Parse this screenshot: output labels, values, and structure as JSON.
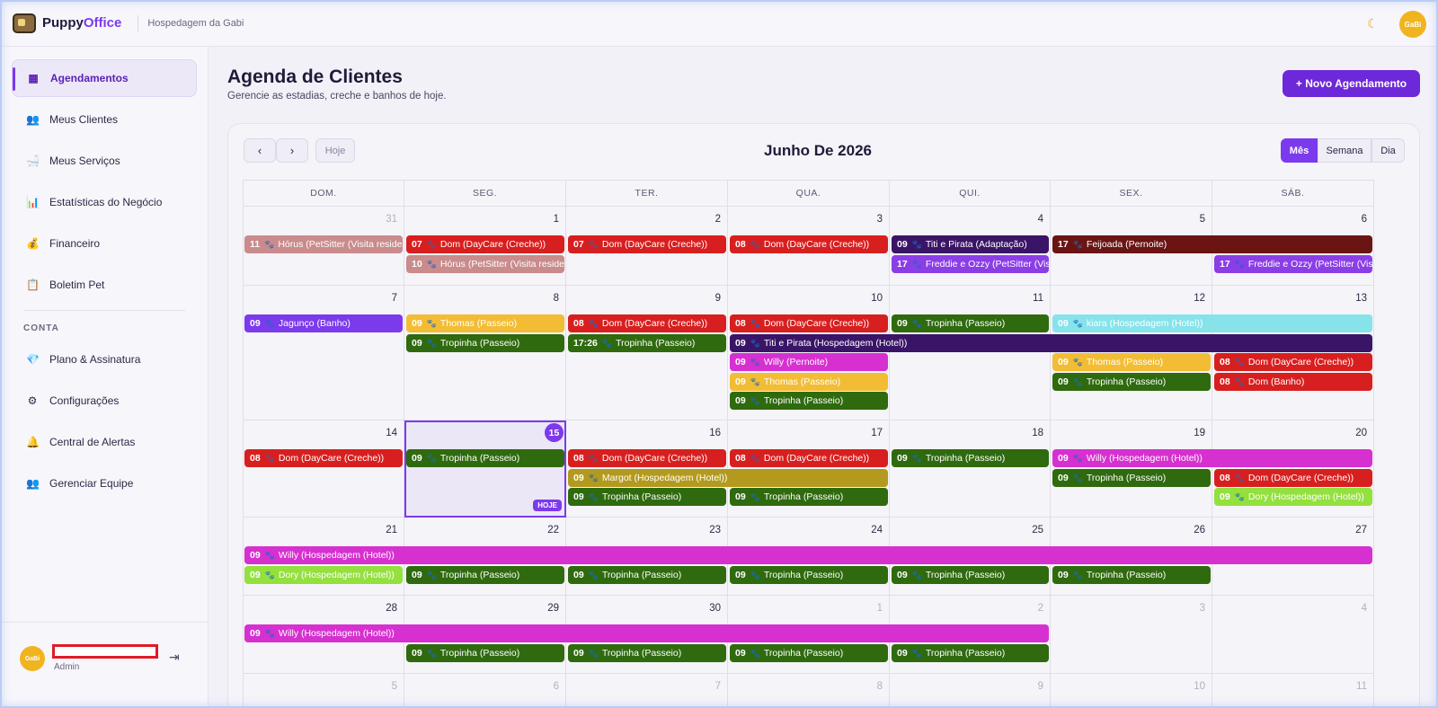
{
  "app": {
    "name_part1": "Puppy",
    "name_part2": "Office",
    "org": "Hospedagem da Gabi",
    "avatar_label": "GaBi"
  },
  "sidebar": {
    "items": [
      {
        "label": "Agendamentos",
        "icon": "calendar-icon",
        "glyph": "▦",
        "active": true
      },
      {
        "label": "Meus Clientes",
        "icon": "users-icon",
        "glyph": "👥",
        "active": false
      },
      {
        "label": "Meus Serviços",
        "icon": "bathtub-icon",
        "glyph": "🛁",
        "active": false
      },
      {
        "label": "Estatísticas do Negócio",
        "icon": "chart-icon",
        "glyph": "📊",
        "active": false
      },
      {
        "label": "Financeiro",
        "icon": "money-bag-icon",
        "glyph": "💰",
        "active": false
      },
      {
        "label": "Boletim Pet",
        "icon": "clipboard-icon",
        "glyph": "📋",
        "active": false
      }
    ],
    "section_label": "CONTA",
    "account_items": [
      {
        "label": "Plano & Assinatura",
        "icon": "diamond-icon",
        "glyph": "💎"
      },
      {
        "label": "Configurações",
        "icon": "gear-icon",
        "glyph": "⚙"
      },
      {
        "label": "Central de Alertas",
        "icon": "bell-icon",
        "glyph": "🔔"
      },
      {
        "label": "Gerenciar Equipe",
        "icon": "team-icon",
        "glyph": "👥"
      }
    ],
    "user": {
      "role": "Admin"
    }
  },
  "header": {
    "title": "Agenda de Clientes",
    "subtitle": "Gerencie as estadias, creche e banhos de hoje.",
    "new_button": "+ Novo Agendamento"
  },
  "calendar": {
    "title": "Junho De 2026",
    "prev": "‹",
    "next": "›",
    "today": "Hoje",
    "views": [
      "Mês",
      "Semana",
      "Dia"
    ],
    "active_view": "Mês",
    "weekdays": [
      "DOM.",
      "SEG.",
      "TER.",
      "QUA.",
      "QUI.",
      "SEX.",
      "SÁB."
    ],
    "today_badge": "HOJE",
    "today_date": 15,
    "weeks": [
      [
        {
          "d": 31,
          "o": true
        },
        {
          "d": 1
        },
        {
          "d": 2
        },
        {
          "d": 3
        },
        {
          "d": 4
        },
        {
          "d": 5
        },
        {
          "d": 6
        }
      ],
      [
        {
          "d": 7
        },
        {
          "d": 8
        },
        {
          "d": 9
        },
        {
          "d": 10
        },
        {
          "d": 11
        },
        {
          "d": 12
        },
        {
          "d": 13
        }
      ],
      [
        {
          "d": 14
        },
        {
          "d": 15
        },
        {
          "d": 16
        },
        {
          "d": 17
        },
        {
          "d": 18
        },
        {
          "d": 19
        },
        {
          "d": 20
        }
      ],
      [
        {
          "d": 21
        },
        {
          "d": 22
        },
        {
          "d": 23
        },
        {
          "d": 24
        },
        {
          "d": 25
        },
        {
          "d": 26
        },
        {
          "d": 27
        }
      ],
      [
        {
          "d": 28
        },
        {
          "d": 29
        },
        {
          "d": 30
        },
        {
          "d": 1,
          "o": true
        },
        {
          "d": 2,
          "o": true
        },
        {
          "d": 3,
          "o": true
        },
        {
          "d": 4,
          "o": true
        }
      ],
      [
        {
          "d": 5,
          "o": true
        },
        {
          "d": 6,
          "o": true
        },
        {
          "d": 7,
          "o": true
        },
        {
          "d": 8,
          "o": true
        },
        {
          "d": 9,
          "o": true
        },
        {
          "d": 10,
          "o": true
        },
        {
          "d": 11,
          "o": true
        }
      ]
    ],
    "colors": {
      "red": "#d81f1f",
      "rose": "#c98b8b",
      "navy": "#3a1567",
      "maroon": "#6b1414",
      "violet": "#8b3ee6",
      "purple": "#7c3aed",
      "yellow": "#f2bd34",
      "green": "#2f6a0f",
      "cyan": "#86e3ea",
      "magenta": "#d630d0",
      "olive": "#b39a1e",
      "lime": "#93e03e"
    },
    "events": [
      {
        "w": 0,
        "s": 0,
        "e": 0,
        "r": 0,
        "t": "11",
        "label": "Hórus (PetSitter (Visita residencial))",
        "c": "rose"
      },
      {
        "w": 0,
        "s": 1,
        "e": 1,
        "r": 0,
        "t": "07",
        "label": "Dom (DayCare (Creche))",
        "c": "red"
      },
      {
        "w": 0,
        "s": 1,
        "e": 1,
        "r": 1,
        "t": "10",
        "label": "Hórus (PetSitter (Visita residencial))",
        "c": "rose"
      },
      {
        "w": 0,
        "s": 2,
        "e": 2,
        "r": 0,
        "t": "07",
        "label": "Dom (DayCare (Creche))",
        "c": "red"
      },
      {
        "w": 0,
        "s": 3,
        "e": 3,
        "r": 0,
        "t": "08",
        "label": "Dom (DayCare (Creche))",
        "c": "red"
      },
      {
        "w": 0,
        "s": 4,
        "e": 4,
        "r": 0,
        "t": "09",
        "label": "Titi e Pirata (Adaptação)",
        "c": "navy"
      },
      {
        "w": 0,
        "s": 4,
        "e": 4,
        "r": 1,
        "t": "17",
        "label": "Freddie e Ozzy (PetSitter (Visita residencial))",
        "c": "violet"
      },
      {
        "w": 0,
        "s": 5,
        "e": 6,
        "r": 0,
        "t": "17",
        "label": "Feijoada (Pernoite)",
        "c": "maroon"
      },
      {
        "w": 0,
        "s": 6,
        "e": 6,
        "r": 1,
        "t": "17",
        "label": "Freddie e Ozzy (PetSitter (Visita residencial))",
        "c": "violet"
      },
      {
        "w": 1,
        "s": 0,
        "e": 0,
        "r": 0,
        "t": "09",
        "label": "Jagunço (Banho)",
        "c": "purple"
      },
      {
        "w": 1,
        "s": 1,
        "e": 1,
        "r": 0,
        "t": "09",
        "label": "Thomas (Passeio)",
        "c": "yellow"
      },
      {
        "w": 1,
        "s": 1,
        "e": 1,
        "r": 1,
        "t": "09",
        "label": "Tropinha (Passeio)",
        "c": "green"
      },
      {
        "w": 1,
        "s": 2,
        "e": 2,
        "r": 0,
        "t": "08",
        "label": "Dom (DayCare (Creche))",
        "c": "red"
      },
      {
        "w": 1,
        "s": 2,
        "e": 2,
        "r": 1,
        "t": "17:26",
        "label": "Tropinha (Passeio)",
        "c": "green"
      },
      {
        "w": 1,
        "s": 3,
        "e": 3,
        "r": 0,
        "t": "08",
        "label": "Dom (DayCare (Creche))",
        "c": "red"
      },
      {
        "w": 1,
        "s": 3,
        "e": 6,
        "r": 1,
        "t": "09",
        "label": "Titi e Pirata (Hospedagem (Hotel))",
        "c": "navy"
      },
      {
        "w": 1,
        "s": 3,
        "e": 3,
        "r": 2,
        "t": "09",
        "label": "Willy (Pernoite)",
        "c": "magenta"
      },
      {
        "w": 1,
        "s": 3,
        "e": 3,
        "r": 3,
        "t": "09",
        "label": "Thomas (Passeio)",
        "c": "yellow"
      },
      {
        "w": 1,
        "s": 3,
        "e": 3,
        "r": 4,
        "t": "09",
        "label": "Tropinha (Passeio)",
        "c": "green"
      },
      {
        "w": 1,
        "s": 4,
        "e": 4,
        "r": 0,
        "t": "09",
        "label": "Tropinha (Passeio)",
        "c": "green"
      },
      {
        "w": 1,
        "s": 5,
        "e": 6,
        "r": 0,
        "t": "09",
        "label": "kiara (Hospedagem (Hotel))",
        "c": "cyan"
      },
      {
        "w": 1,
        "s": 5,
        "e": 5,
        "r": 2,
        "t": "09",
        "label": "Thomas (Passeio)",
        "c": "yellow"
      },
      {
        "w": 1,
        "s": 5,
        "e": 5,
        "r": 3,
        "t": "09",
        "label": "Tropinha (Passeio)",
        "c": "green"
      },
      {
        "w": 1,
        "s": 6,
        "e": 6,
        "r": 2,
        "t": "08",
        "label": "Dom (DayCare (Creche))",
        "c": "red"
      },
      {
        "w": 1,
        "s": 6,
        "e": 6,
        "r": 3,
        "t": "08",
        "label": "Dom (Banho)",
        "c": "red"
      },
      {
        "w": 2,
        "s": 0,
        "e": 0,
        "r": 0,
        "t": "08",
        "label": "Dom (DayCare (Creche))",
        "c": "red"
      },
      {
        "w": 2,
        "s": 1,
        "e": 1,
        "r": 0,
        "t": "09",
        "label": "Tropinha (Passeio)",
        "c": "green"
      },
      {
        "w": 2,
        "s": 2,
        "e": 2,
        "r": 0,
        "t": "08",
        "label": "Dom (DayCare (Creche))",
        "c": "red"
      },
      {
        "w": 2,
        "s": 2,
        "e": 3,
        "r": 1,
        "t": "09",
        "label": "Margot (Hospedagem (Hotel))",
        "c": "olive"
      },
      {
        "w": 2,
        "s": 2,
        "e": 2,
        "r": 2,
        "t": "09",
        "label": "Tropinha (Passeio)",
        "c": "green"
      },
      {
        "w": 2,
        "s": 3,
        "e": 3,
        "r": 0,
        "t": "08",
        "label": "Dom (DayCare (Creche))",
        "c": "red"
      },
      {
        "w": 2,
        "s": 3,
        "e": 3,
        "r": 2,
        "t": "09",
        "label": "Tropinha (Passeio)",
        "c": "green"
      },
      {
        "w": 2,
        "s": 4,
        "e": 4,
        "r": 0,
        "t": "09",
        "label": "Tropinha (Passeio)",
        "c": "green"
      },
      {
        "w": 2,
        "s": 5,
        "e": 6,
        "r": 0,
        "t": "09",
        "label": "Willy (Hospedagem (Hotel))",
        "c": "magenta"
      },
      {
        "w": 2,
        "s": 5,
        "e": 5,
        "r": 1,
        "t": "09",
        "label": "Tropinha (Passeio)",
        "c": "green"
      },
      {
        "w": 2,
        "s": 6,
        "e": 6,
        "r": 1,
        "t": "08",
        "label": "Dom (DayCare (Creche))",
        "c": "red"
      },
      {
        "w": 2,
        "s": 6,
        "e": 6,
        "r": 2,
        "t": "09",
        "label": "Dory (Hospedagem (Hotel))",
        "c": "lime"
      },
      {
        "w": 3,
        "s": 0,
        "e": 6,
        "r": 0,
        "t": "09",
        "label": "Willy (Hospedagem (Hotel))",
        "c": "magenta"
      },
      {
        "w": 3,
        "s": 0,
        "e": 0,
        "r": 1,
        "t": "09",
        "label": "Dory (Hospedagem (Hotel))",
        "c": "lime"
      },
      {
        "w": 3,
        "s": 1,
        "e": 1,
        "r": 1,
        "t": "09",
        "label": "Tropinha (Passeio)",
        "c": "green"
      },
      {
        "w": 3,
        "s": 2,
        "e": 2,
        "r": 1,
        "t": "09",
        "label": "Tropinha (Passeio)",
        "c": "green"
      },
      {
        "w": 3,
        "s": 3,
        "e": 3,
        "r": 1,
        "t": "09",
        "label": "Tropinha (Passeio)",
        "c": "green"
      },
      {
        "w": 3,
        "s": 4,
        "e": 4,
        "r": 1,
        "t": "09",
        "label": "Tropinha (Passeio)",
        "c": "green"
      },
      {
        "w": 3,
        "s": 5,
        "e": 5,
        "r": 1,
        "t": "09",
        "label": "Tropinha (Passeio)",
        "c": "green"
      },
      {
        "w": 4,
        "s": 0,
        "e": 4,
        "r": 0,
        "t": "09",
        "label": "Willy (Hospedagem (Hotel))",
        "c": "magenta"
      },
      {
        "w": 4,
        "s": 1,
        "e": 1,
        "r": 1,
        "t": "09",
        "label": "Tropinha (Passeio)",
        "c": "green"
      },
      {
        "w": 4,
        "s": 2,
        "e": 2,
        "r": 1,
        "t": "09",
        "label": "Tropinha (Passeio)",
        "c": "green"
      },
      {
        "w": 4,
        "s": 3,
        "e": 3,
        "r": 1,
        "t": "09",
        "label": "Tropinha (Passeio)",
        "c": "green"
      },
      {
        "w": 4,
        "s": 4,
        "e": 4,
        "r": 1,
        "t": "09",
        "label": "Tropinha (Passeio)",
        "c": "green"
      }
    ]
  }
}
